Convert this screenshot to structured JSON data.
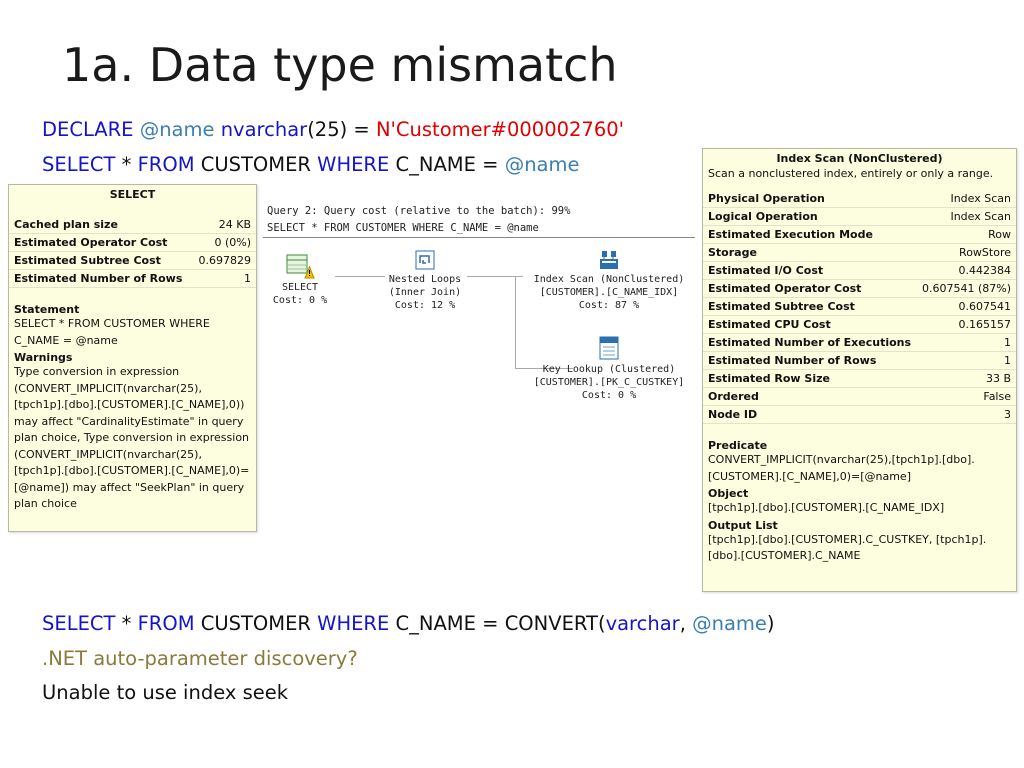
{
  "slide": {
    "title": "1a. Data type mismatch"
  },
  "query1": {
    "line1": {
      "declare": "DECLARE",
      "var": "@name",
      "type": "nvarchar",
      "size": "(25) =",
      "literal": "N'Customer#000002760'"
    },
    "line2": {
      "select": "SELECT",
      "star": "*",
      "from": "FROM",
      "table": "CUSTOMER",
      "where": "WHERE",
      "cond": "C_NAME =",
      "var": "@name"
    }
  },
  "select_tooltip": {
    "header": "SELECT",
    "rows": [
      {
        "k": "Cached plan size",
        "v": "24 KB"
      },
      {
        "k": "Estimated Operator Cost",
        "v": "0 (0%)"
      },
      {
        "k": "Estimated Subtree Cost",
        "v": "0.697829"
      },
      {
        "k": "Estimated Number of Rows",
        "v": "1"
      }
    ],
    "statement_label": "Statement",
    "statement_lines": [
      "SELECT * FROM CUSTOMER WHERE",
      "C_NAME = @name"
    ],
    "warnings_label": "Warnings",
    "warnings_lines": [
      "Type conversion in expression",
      "(CONVERT_IMPLICIT(nvarchar(25),",
      "[tpch1p].[dbo].[CUSTOMER].[C_NAME],0))",
      "may affect \"CardinalityEstimate\" in query",
      "plan choice, Type conversion in expression",
      "(CONVERT_IMPLICIT(nvarchar(25),",
      "[tpch1p].[dbo].[CUSTOMER].[C_NAME],0)=",
      "[@name]) may affect \"SeekPlan\" in query",
      "plan choice"
    ]
  },
  "plan": {
    "header1": "Query 2: Query cost (relative to the batch): 99%",
    "header2": "SELECT * FROM CUSTOMER WHERE C_NAME = @name",
    "ops": {
      "select": {
        "name": "SELECT",
        "cost": "Cost: 0 %",
        "icon": "select-warning-icon"
      },
      "nested": {
        "name": "Nested Loops",
        "sub": "(Inner Join)",
        "cost": "Cost: 12 %",
        "icon": "nested-loops-icon"
      },
      "scan": {
        "name": "Index Scan (NonClustered)",
        "sub": "[CUSTOMER].[C_NAME_IDX]",
        "cost": "Cost: 87 %",
        "icon": "index-scan-icon"
      },
      "lookup": {
        "name": "Key Lookup (Clustered)",
        "sub": "[CUSTOMER].[PK_C_CUSTKEY]",
        "cost": "Cost: 0 %",
        "icon": "key-lookup-icon"
      }
    }
  },
  "scan_tooltip": {
    "header": "Index Scan (NonClustered)",
    "desc": "Scan a nonclustered index, entirely or only a range.",
    "rows": [
      {
        "k": "Physical Operation",
        "v": "Index Scan"
      },
      {
        "k": "Logical Operation",
        "v": "Index Scan"
      },
      {
        "k": "Estimated Execution Mode",
        "v": "Row"
      },
      {
        "k": "Storage",
        "v": "RowStore"
      },
      {
        "k": "Estimated I/O Cost",
        "v": "0.442384"
      },
      {
        "k": "Estimated Operator Cost",
        "v": "0.607541 (87%)"
      },
      {
        "k": "Estimated Subtree Cost",
        "v": "0.607541"
      },
      {
        "k": "Estimated CPU Cost",
        "v": "0.165157"
      },
      {
        "k": "Estimated Number of Executions",
        "v": "1"
      },
      {
        "k": "Estimated Number of Rows",
        "v": "1"
      },
      {
        "k": "Estimated Row Size",
        "v": "33 B"
      },
      {
        "k": "Ordered",
        "v": "False"
      },
      {
        "k": "Node ID",
        "v": "3"
      }
    ],
    "predicate_label": "Predicate",
    "predicate_lines": [
      "CONVERT_IMPLICIT(nvarchar(25),[tpch1p].[dbo].",
      "[CUSTOMER].[C_NAME],0)=[@name]"
    ],
    "object_label": "Object",
    "object_lines": [
      "[tpch1p].[dbo].[CUSTOMER].[C_NAME_IDX]"
    ],
    "output_label": "Output List",
    "output_lines": [
      "[tpch1p].[dbo].[CUSTOMER].C_CUSTKEY, [tpch1p].",
      "[dbo].[CUSTOMER].C_NAME"
    ]
  },
  "query2": {
    "select": "SELECT",
    "star": "*",
    "from": "FROM",
    "table": "CUSTOMER",
    "where": "WHERE",
    "cond": "C_NAME = CONVERT(",
    "type": "varchar",
    "comma": ",",
    "var": "@name",
    "close": ")"
  },
  "notes": {
    "net": ".NET auto-parameter discovery?",
    "seek": "Unable to use index seek"
  },
  "colors": {
    "keyword": "#1515c8",
    "variable": "#3a7fb0",
    "string": "#e00000",
    "note": "#8a7a3c",
    "tooltip_bg": "#fdfde0"
  }
}
